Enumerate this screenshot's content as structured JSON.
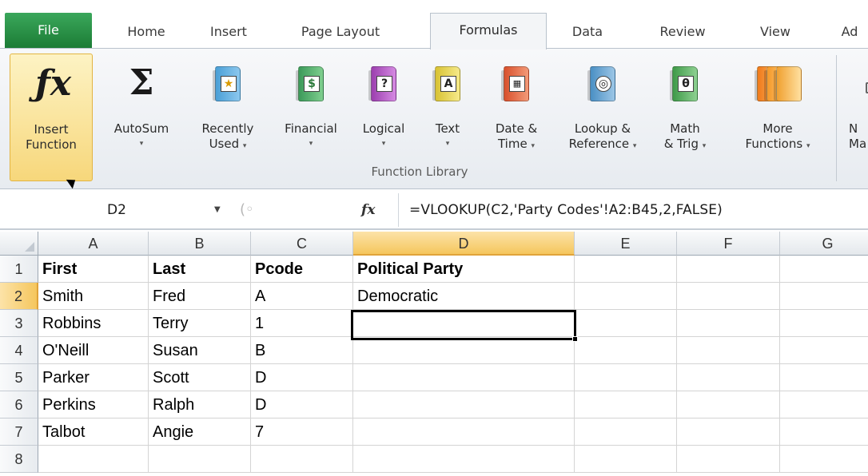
{
  "ribbon_tabs": [
    {
      "label": "File"
    },
    {
      "label": "Home"
    },
    {
      "label": "Insert"
    },
    {
      "label": "Page Layout"
    },
    {
      "label": "Formulas"
    },
    {
      "label": "Data"
    },
    {
      "label": "Review"
    },
    {
      "label": "View"
    },
    {
      "label": "Ad"
    }
  ],
  "active_tab": "Formulas",
  "ribbon": {
    "insert_function": {
      "line1": "Insert",
      "line2": "Function",
      "icon": "fx-icon"
    },
    "autosum": {
      "line1": "AutoSum",
      "icon": "sigma-icon"
    },
    "recently_used": {
      "line1": "Recently",
      "line2": "Used",
      "icon": "book-star-icon"
    },
    "financial": {
      "line1": "Financial",
      "icon": "book-money-icon"
    },
    "logical": {
      "line1": "Logical",
      "icon": "book-question-icon"
    },
    "text": {
      "line1": "Text",
      "icon": "book-letter-a-icon"
    },
    "date_time": {
      "line1": "Date &",
      "line2": "Time",
      "icon": "book-calendar-icon"
    },
    "lookup_reference": {
      "line1": "Lookup &",
      "line2": "Reference",
      "icon": "book-magnifier-icon"
    },
    "math_trig": {
      "line1": "Math",
      "line2": "& Trig",
      "icon": "book-theta-icon"
    },
    "more_functions": {
      "line1": "More",
      "line2": "Functions",
      "icon": "books-stack-icon"
    },
    "name_manager_partial": {
      "line1": "N",
      "line2": "Ma"
    },
    "group_label": "Function Library",
    "dropdown_arrow": "▾"
  },
  "formula_bar": {
    "name_box": "D2",
    "fx_label": "fx",
    "formula": "=VLOOKUP(C2,'Party Codes'!A2:B45,2,FALSE)"
  },
  "sheet": {
    "columns": [
      "A",
      "B",
      "C",
      "D",
      "E",
      "F",
      "G"
    ],
    "rows": [
      "1",
      "2",
      "3",
      "4",
      "5",
      "6",
      "7",
      "8"
    ],
    "selected_column": "D",
    "selected_row": "2",
    "cells": [
      [
        "First",
        "Last",
        "Pcode",
        "Political Party",
        "",
        "",
        ""
      ],
      [
        "Smith",
        "Fred",
        "A",
        "Democratic",
        "",
        "",
        ""
      ],
      [
        "Robbins",
        "Terry",
        "1",
        "",
        "",
        "",
        ""
      ],
      [
        "O'Neill",
        "Susan",
        "B",
        "",
        "",
        "",
        ""
      ],
      [
        "Parker",
        "Scott",
        "D",
        "",
        "",
        "",
        ""
      ],
      [
        "Perkins",
        "Ralph",
        "D",
        "",
        "",
        "",
        ""
      ],
      [
        "Talbot",
        "Angie",
        "7",
        "",
        "",
        "",
        ""
      ],
      [
        "",
        "",
        "",
        "",
        "",
        "",
        ""
      ]
    ]
  },
  "colors": {
    "file_tab": "#1f8a3d",
    "selection_header": "#f5c65d",
    "active_border": "#000000"
  }
}
